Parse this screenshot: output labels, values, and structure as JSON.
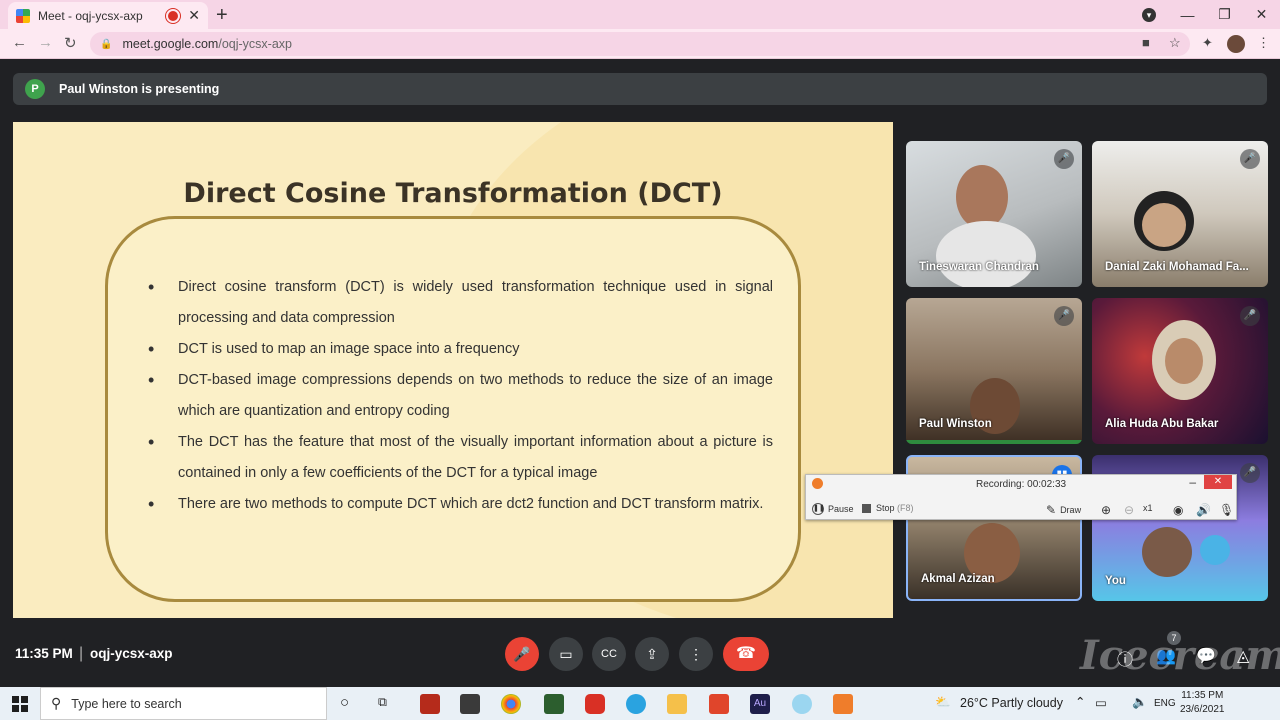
{
  "browser": {
    "tab_title": "Meet - oqj-ycsx-axp",
    "url_host": "meet.google.com",
    "url_path": "/oqj-ycsx-axp"
  },
  "banner": {
    "initial": "P",
    "text": "Paul Winston is presenting"
  },
  "slide": {
    "title": "Direct Cosine Transformation (DCT)",
    "bullets": [
      "Direct cosine transform (DCT) is widely used transformation technique used in signal processing and data compression",
      "DCT is used to map an image space into a frequency",
      "DCT-based image compressions depends on two methods to reduce the size of an image which are quantization and entropy coding",
      "The DCT has the feature that most of the visually important information about a picture is contained in only a few coefficients of the DCT for a typical image",
      "There are two methods to compute DCT which are dct2 function and DCT transform matrix."
    ]
  },
  "participants": [
    {
      "name": "Tineswaran Chandran"
    },
    {
      "name": "Danial Zaki Mohamad Fa..."
    },
    {
      "name": "Paul Winston"
    },
    {
      "name": "Alia Huda Abu Bakar"
    },
    {
      "name": "Akmal Azizan"
    },
    {
      "name": "You"
    }
  ],
  "recorder": {
    "status": "Recording:",
    "time": "00:02:33",
    "pause": "Pause",
    "stop": "Stop",
    "stop_key": "(F8)",
    "draw": "Draw",
    "zoom": "x1"
  },
  "controls": {
    "time": "11:35 PM",
    "meeting_code": "oqj-ycsx-axp",
    "people_count": "7"
  },
  "watermark": "Icecream",
  "taskbar": {
    "search_placeholder": "Type here to search",
    "weather": "26°C  Partly cloudy",
    "lang": "ENG",
    "time": "11:35 PM",
    "date": "23/6/2021"
  }
}
